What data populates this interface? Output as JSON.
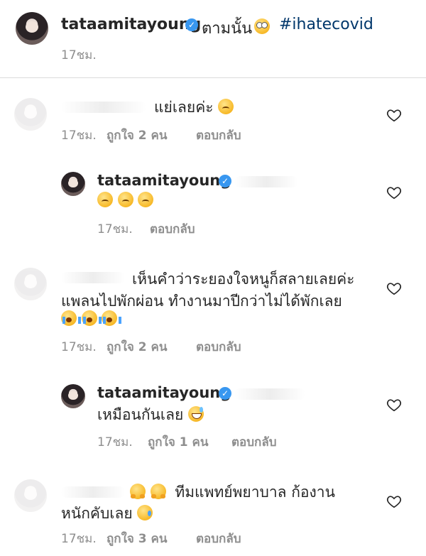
{
  "post": {
    "username": "tataamitayoung",
    "caption": "ตามนั้น",
    "hashtag": "#ihatecovid",
    "time": "17ชม."
  },
  "comments": [
    {
      "text": "แย่เลยค่ะ",
      "time": "17ชม.",
      "likes": "ถูกใจ 2 คน",
      "reply": "ตอบกลับ"
    },
    {
      "username": "tataamitayoung",
      "time": "17ชม.",
      "reply": "ตอบกลับ"
    },
    {
      "line1": "เห็นคำว่าระยองใจหนูก็สลายเลยค่ะ",
      "line2": "แพลนไปพักผ่อน ทำงานมาปีกว่าไม่ได้พักเลย",
      "time": "17ชม.",
      "likes": "ถูกใจ 2 คน",
      "reply": "ตอบกลับ"
    },
    {
      "username": "tataamitayoung",
      "text": "เหมือนกันเลย",
      "time": "17ชม.",
      "likes": "ถูกใจ 1 คน",
      "reply": "ตอบกลับ"
    },
    {
      "line1": "ทีมแพทย์พยาบาล ก้องาน",
      "line2": "หนักคับเลย",
      "time": "17ชม.",
      "likes": "ถูกใจ 3 คน",
      "reply": "ตอบกลับ"
    }
  ],
  "icons": {
    "verified": "verified-badge-icon",
    "heart": "heart-outline-icon"
  },
  "colors": {
    "verified": "#3897f0",
    "hashtag": "#00376b",
    "meta": "#8e8e8e"
  }
}
